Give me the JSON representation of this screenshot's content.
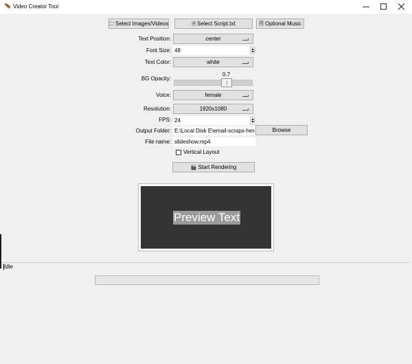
{
  "window": {
    "title": "Video Creator Tool",
    "minimize_glyph": "—",
    "maximize_glyph": "☐",
    "close_glyph": "✕"
  },
  "toolbar": {
    "select_media_icon": "🗀",
    "select_media_label": "Select Images/Videos",
    "select_script_icon": "🗎",
    "select_script_label": "Select Script.txt",
    "optional_music_icon": "🗐",
    "optional_music_label": "Optional Music"
  },
  "form": {
    "text_position": {
      "label": "Text Position:",
      "value": "center"
    },
    "font_size": {
      "label": "Font Size:",
      "value": "48"
    },
    "text_color": {
      "label": "Text Color:",
      "value": "white"
    },
    "bg_opacity": {
      "label": "BG Opacity:",
      "value": "0.7",
      "min": 0,
      "max": 1
    },
    "voice": {
      "label": "Voice:",
      "value": "female"
    },
    "resolution": {
      "label": "Resolution:",
      "value": "1920x1080"
    },
    "fps": {
      "label": "FPS:",
      "value": "24"
    },
    "output_folder": {
      "label": "Output Folder:",
      "value": "E:\\Local Disk E\\email-scraps-here\\",
      "browse_label": "Browse"
    },
    "file_name": {
      "label": "File name:",
      "value": "slideshow.mp4"
    },
    "vertical_layout": {
      "label": "Vertical Layout",
      "checked": false
    }
  },
  "render": {
    "icon": "🎬",
    "label": "Start Rendering"
  },
  "preview": {
    "text": "Preview Text",
    "canvas_color": "#333333",
    "text_bg_color": "#9a9a9a",
    "text_color": "#ffffff"
  },
  "status": {
    "text": "Idle",
    "progress": 0
  }
}
